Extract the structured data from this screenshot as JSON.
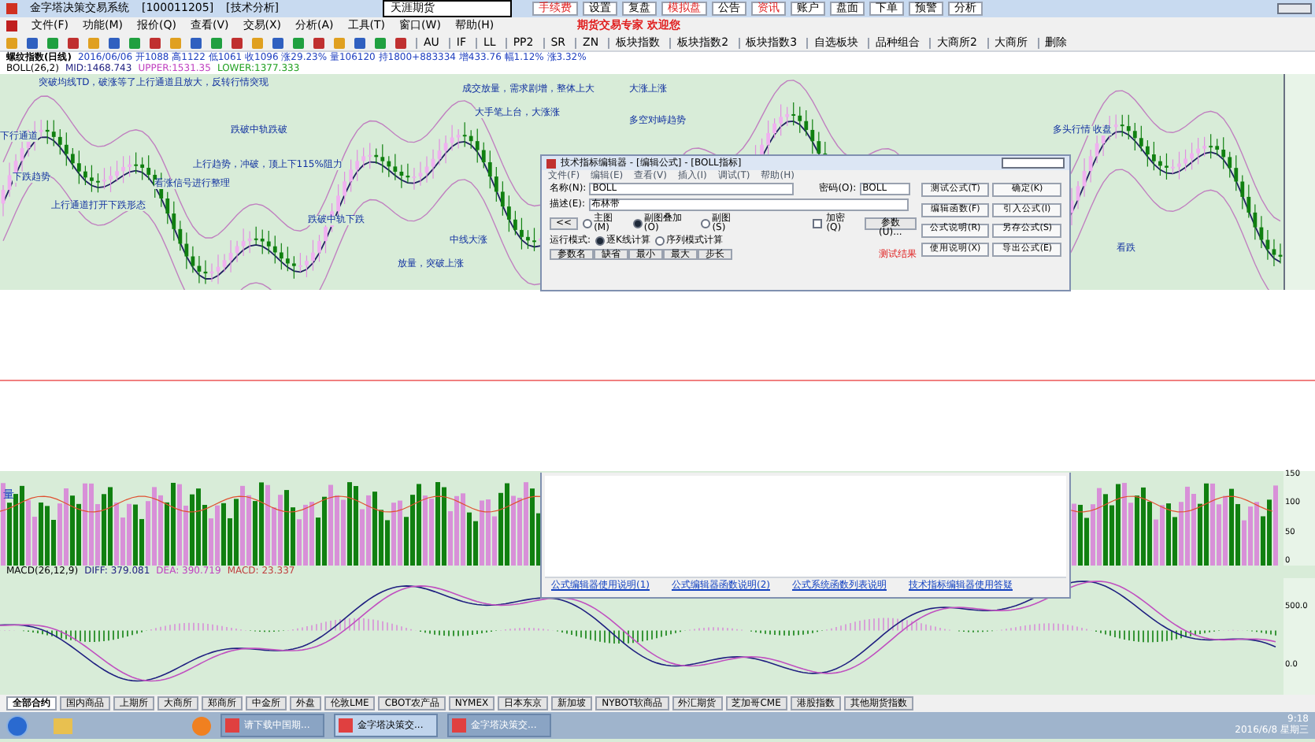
{
  "window": {
    "title": "金字塔决策交易系统",
    "account": "[100011205]",
    "mode": "[技术分析]"
  },
  "menu": [
    "文件(F)",
    "功能(M)",
    "报价(Q)",
    "查看(V)",
    "交易(X)",
    "分析(A)",
    "工具(T)",
    "窗口(W)",
    "帮助(H)"
  ],
  "toolbar_links": [
    "AU",
    "IF",
    "LL",
    "PP2",
    "SR",
    "ZN",
    "板块指数",
    "板块指数2",
    "板块指数3",
    "自选板块",
    "品种组合",
    "大商所2",
    "大商所",
    "删除"
  ],
  "search": {
    "value": "天涯期货"
  },
  "promo": "期货交易专家 欢迎您",
  "top_buttons": [
    {
      "label": "手续费",
      "red": true
    },
    {
      "label": "设置",
      "red": false
    },
    {
      "label": "复盘",
      "red": false
    },
    {
      "label": "模拟盘",
      "red": true
    },
    {
      "label": "公告",
      "red": false
    },
    {
      "label": "资讯",
      "red": true
    },
    {
      "label": "账户",
      "red": false
    },
    {
      "label": "盘面",
      "red": false
    },
    {
      "label": "下单",
      "red": false
    },
    {
      "label": "预警",
      "red": false
    },
    {
      "label": "分析",
      "red": false
    }
  ],
  "chart_header": {
    "title": "螺纹指数(日线)",
    "quote": "2016/06/06 开1088 高1122 低1061 收1096 涨29.23% 量106120 持1800+883334 增433.76 幅1.12% 涨3.32%",
    "indicator": "BOLL(26,2)",
    "values": [
      "MID:1468.743",
      "UPPER:1531.35",
      "LOWER:1377.333"
    ]
  },
  "annotations": [
    "突破均线TD，破涨等了上行通道且放大，反转行情突现",
    "成交放量，需求剧增，整体上大",
    "大手笔上台，大涨涨",
    "下行通道",
    "跌破中轨跌破",
    "上行趋势，冲破，顶上下115%阻力",
    "下跌趋势",
    "上行通道打开下跌形态",
    "看涨信号进行整理",
    "跌破中轨下跌",
    "中线大涨",
    "放量，突破上涨",
    "大涨上涨",
    "多空对峙趋势",
    "多头行情 收盘",
    "看跌"
  ],
  "dialog": {
    "title": "技术指标编辑器 - [编辑公式] - [BOLL指标]",
    "menu": [
      "文件(F)",
      "编辑(E)",
      "查看(V)",
      "插入(I)",
      "调试(T)",
      "帮助(H)"
    ],
    "name_label": "名称(N):",
    "name": "BOLL",
    "password_label": "密码(O):",
    "password": "BOLL",
    "desc_label": "描述(E):",
    "desc": "布林带",
    "collapse": "<<",
    "chart_types": [
      {
        "label": "主图(M)",
        "selected": false
      },
      {
        "label": "副图叠加(O)",
        "selected": true
      },
      {
        "label": "副图(S)",
        "selected": false
      }
    ],
    "encrypt": {
      "label": "加密(Q)",
      "checked": false
    },
    "params_button": "参数(U)...",
    "run_label": "运行模式:",
    "run_modes": [
      {
        "label": "逐K线计算",
        "selected": true
      },
      {
        "label": "序列模式计算",
        "selected": false
      }
    ],
    "buttons": [
      "测试公式(T)",
      "确定(K)",
      "编辑函数(F)",
      "引入公式(I)",
      "公式说明(R)",
      "另存公式(S)",
      "使用说明(X)",
      "导出公式(E)"
    ],
    "param_columns": [
      "参数名",
      "缺省",
      "最小",
      "最大",
      "步长"
    ],
    "test_result": "测试结果",
    "links": [
      "公式编辑器使用说明(1)",
      "公式编辑器函数说明(2)",
      "公式系统函数列表说明",
      "技术指标编辑器使用答疑"
    ]
  },
  "volume": {
    "label": "量",
    "ticks": [
      "150",
      "100",
      "50",
      "0"
    ]
  },
  "macd": {
    "label": "MACD(26,12,9)",
    "diff": "DIFF: 379.081",
    "dea": "DEA: 390.719",
    "macd": "MACD: 23.337",
    "ticks": [
      "500.0",
      "0.0"
    ]
  },
  "bottom_tabs": [
    {
      "label": "全部合约",
      "selected": true
    },
    {
      "label": "国内商品",
      "selected": false
    },
    {
      "label": "上期所",
      "selected": false
    },
    {
      "label": "大商所",
      "selected": false
    },
    {
      "label": "郑商所",
      "selected": false
    },
    {
      "label": "中金所",
      "selected": false
    },
    {
      "label": "外盘",
      "selected": false
    },
    {
      "label": "伦敦LME",
      "selected": false
    },
    {
      "label": "CBOT农产品",
      "selected": false
    },
    {
      "label": "NYMEX",
      "selected": false
    },
    {
      "label": "日本东京",
      "selected": false
    },
    {
      "label": "新加坡",
      "selected": false
    },
    {
      "label": "NYBOT软商品",
      "selected": false
    },
    {
      "label": "外汇期货",
      "selected": false
    },
    {
      "label": "芝加哥CME",
      "selected": false
    },
    {
      "label": "港股指数",
      "selected": false
    },
    {
      "label": "其他期货指数",
      "selected": false
    }
  ],
  "taskbar": {
    "windows": [
      {
        "label": "请下载中国期...",
        "selected": false
      },
      {
        "label": "金字塔决策交...",
        "selected": true
      },
      {
        "label": "金字塔决策交...",
        "selected": false
      }
    ],
    "time": "9:18",
    "date": "2016/6/8 星期三"
  }
}
